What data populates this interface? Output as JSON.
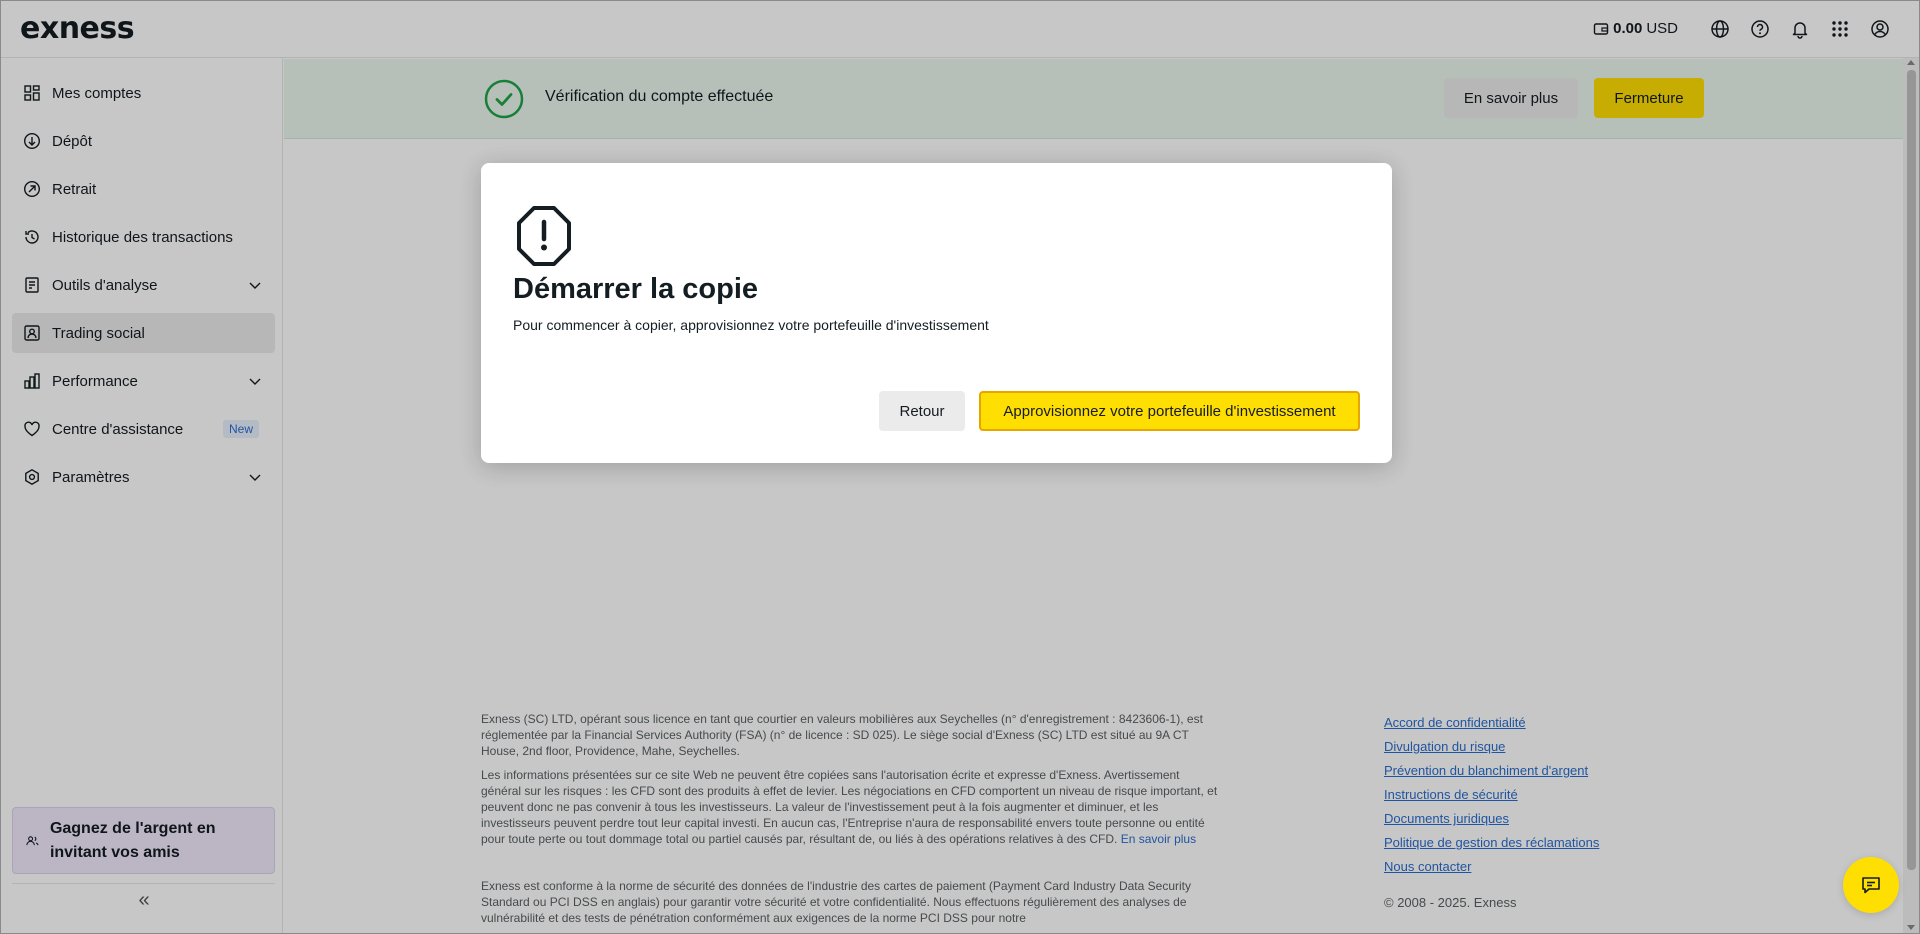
{
  "header": {
    "logo": "exness",
    "balance_amount": "0.00",
    "balance_currency": "USD"
  },
  "sidebar": {
    "items": [
      {
        "label": "Mes comptes",
        "icon": "grid-icon"
      },
      {
        "label": "Dépôt",
        "icon": "arrow-down-circle-icon"
      },
      {
        "label": "Retrait",
        "icon": "arrow-up-right-circle-icon"
      },
      {
        "label": "Historique des transactions",
        "icon": "history-icon"
      },
      {
        "label": "Outils d'analyse",
        "icon": "analysis-icon"
      },
      {
        "label": "Trading social",
        "icon": "social-trading-icon"
      },
      {
        "label": "Performance",
        "icon": "bar-chart-icon"
      },
      {
        "label": "Centre d'assistance",
        "icon": "heart-icon",
        "badge": "New"
      },
      {
        "label": "Paramètres",
        "icon": "settings-icon"
      }
    ],
    "promo": "Gagnez de l'argent en invitant vos amis",
    "collapse": "«"
  },
  "banner": {
    "text": "Vérification du compte effectuée",
    "learn_more": "En savoir plus",
    "close": "Fermeture"
  },
  "dialog": {
    "title": "Démarrer la copie",
    "description": "Pour commencer à copier, approvisionnez votre portefeuille d'investissement",
    "back": "Retour",
    "fund": "Approvisionnez votre portefeuille d'investissement"
  },
  "footer": {
    "p1": "Exness (SC) LTD, opérant sous licence en tant que courtier en valeurs mobilières aux Seychelles (n° d'enregistrement : 8423606-1), est réglementée par la Financial Services Authority (FSA) (n° de licence : SD 025). Le siège social d'Exness (SC) LTD est situé au 9A CT House, 2nd floor, Providence, Mahe, Seychelles.",
    "p2": "Les informations présentées sur ce site Web ne peuvent être copiées sans l'autorisation écrite et expresse d'Exness. Avertissement général sur les risques : les CFD sont des produits à effet de levier. Les négociations en CFD comportent un niveau de risque important, et peuvent donc ne pas convenir à tous les investisseurs. La valeur de l'investissement peut à la fois augmenter et diminuer, et les investisseurs peuvent perdre tout leur capital investi. En aucun cas, l'Entreprise n'aura de responsabilité envers toute personne ou entité pour toute perte ou tout dommage total ou partiel causés par, résultant de, ou liés à des opérations relatives à des CFD.",
    "p2_link": "En savoir plus",
    "p3": "Exness est conforme à la norme de sécurité des données de l'industrie des cartes de paiement (Payment Card Industry Data Security Standard ou PCI DSS en anglais) pour garantir votre sécurité et votre confidentialité. Nous effectuons régulièrement des analyses de vulnérabilité et des tests de pénétration conformément aux exigences de la norme PCI DSS pour notre",
    "links": [
      "Accord de confidentialité",
      "Divulgation du risque",
      "Prévention du blanchiment d'argent",
      "Instructions de sécurité",
      "Documents juridiques",
      "Politique de gestion des réclamations",
      "Nous contacter"
    ],
    "copyright": "© 2008 - 2025. Exness"
  },
  "colors": {
    "accent_yellow": "#ffde02",
    "link_blue": "#2a6ecf",
    "success_green": "#1fa34a"
  }
}
